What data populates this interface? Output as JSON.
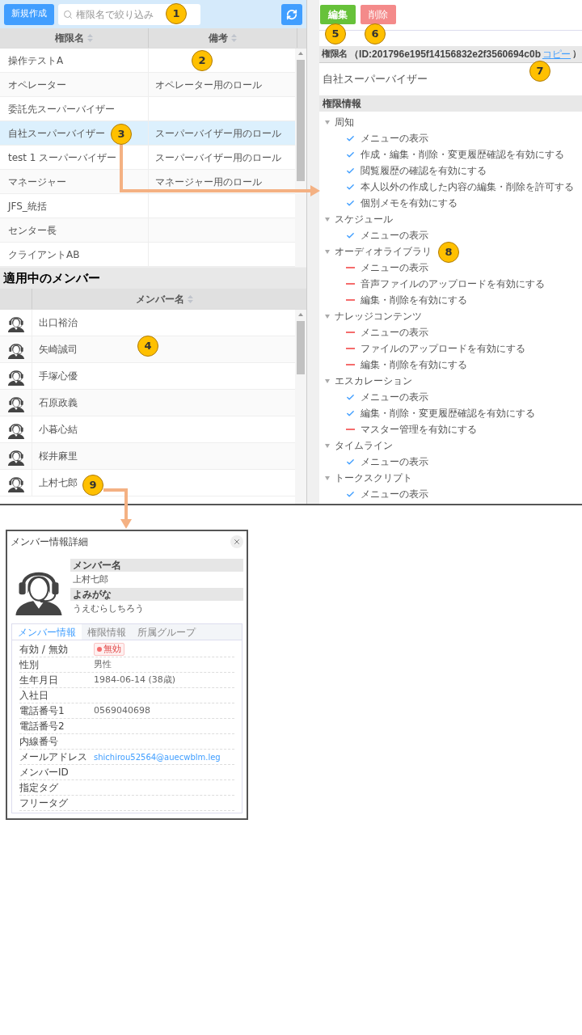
{
  "toolbar": {
    "new_button": "新規作成",
    "search": {
      "placeholder": "権限名で絞り込み"
    }
  },
  "roles_table": {
    "columns": [
      "権限名",
      "備考"
    ],
    "rows": [
      {
        "name": "操作テストA",
        "selected": false
      },
      {
        "name": "オペレーター",
        "note": "オペレーター用のロール",
        "selected": false
      },
      {
        "name": "委託先スーパーバイザー",
        "selected": false
      },
      {
        "name": "自社スーパーバイザー",
        "note": "スーパーバイザー用のロール",
        "selected": true
      },
      {
        "name": "test 1 スーパーバイザー",
        "note": "スーパーバイザー用のロール",
        "selected": false
      },
      {
        "name": "マネージャー",
        "note": "マネージャー用のロール",
        "selected": false
      },
      {
        "name": "JFS_統括",
        "selected": false
      },
      {
        "name": "センター長",
        "selected": false
      },
      {
        "name": "クライアントAB",
        "selected": false
      }
    ]
  },
  "members": {
    "title": "適用中のメンバー",
    "columns": [
      "メンバー名"
    ],
    "rows": [
      {
        "name": "出口裕治"
      },
      {
        "name": "矢崎誠司"
      },
      {
        "name": "手塚心優"
      },
      {
        "name": "石原政義"
      },
      {
        "name": "小暮心結"
      },
      {
        "name": "桜井麻里"
      },
      {
        "name": "上村七郎"
      }
    ]
  },
  "detail": {
    "buttons": [
      {
        "label": "編集",
        "kind": "edit",
        "disabled": false
      },
      {
        "label": "削除",
        "kind": "delete",
        "disabled": true
      }
    ],
    "id_header": {
      "label": "権限名",
      "id": "（ID:201796e195f14156832e2f3560694c0b",
      "copy_link": "コピー",
      "close": "）"
    },
    "name": "自社スーパーバイザー",
    "permissions": {
      "title": "権限情報",
      "groups": [
        {
          "label": "周知",
          "expanded": true,
          "children": [
            {
              "label": "メニューの表示",
              "granted": true
            },
            {
              "label": "作成・編集・削除・変更履歴確認を有効にする",
              "granted": true
            },
            {
              "label": "閲覧履歴の確認を有効にする",
              "granted": true
            },
            {
              "label": "本人以外の作成した内容の編集・削除を許可する",
              "granted": true
            },
            {
              "label": "個別メモを有効にする",
              "granted": true
            }
          ]
        },
        {
          "label": "スケジュール",
          "expanded": true,
          "children": [
            {
              "label": "メニューの表示",
              "granted": true
            }
          ]
        },
        {
          "label": "オーディオライブラリ",
          "expanded": true,
          "children": [
            {
              "label": "メニューの表示",
              "granted": false
            },
            {
              "label": "音声ファイルのアップロードを有効にする",
              "granted": false
            },
            {
              "label": "編集・削除を有効にする",
              "granted": false
            }
          ]
        },
        {
          "label": "ナレッジコンテンツ",
          "expanded": true,
          "children": [
            {
              "label": "メニューの表示",
              "granted": false
            },
            {
              "label": "ファイルのアップロードを有効にする",
              "granted": false
            },
            {
              "label": "編集・削除を有効にする",
              "granted": false
            }
          ]
        },
        {
          "label": "エスカレーション",
          "expanded": true,
          "children": [
            {
              "label": "メニューの表示",
              "granted": true
            },
            {
              "label": "編集・削除・変更履歴確認を有効にする",
              "granted": true
            },
            {
              "label": "マスター管理を有効にする",
              "granted": false
            }
          ]
        },
        {
          "label": "タイムライン",
          "expanded": true,
          "children": [
            {
              "label": "メニューの表示",
              "granted": true
            }
          ]
        },
        {
          "label": "トークスクリプト",
          "expanded": true,
          "children": [
            {
              "label": "メニューの表示",
              "granted": true
            }
          ]
        }
      ]
    }
  },
  "member_dialog": {
    "title": "メンバー情報詳細",
    "fields": [
      {
        "label": "メンバー名",
        "value": "上村七郎"
      },
      {
        "label": "よみがな",
        "value": "うえむらしちろう"
      }
    ],
    "tabs": [
      {
        "label": "メンバー情報",
        "selected": true
      },
      {
        "label": "権限情報",
        "selected": false
      },
      {
        "label": "所属グループ",
        "selected": false
      }
    ],
    "rows": [
      {
        "label": "有効 / 無効",
        "value": "無効",
        "kind": "badge"
      },
      {
        "label": "性別",
        "value": "男性",
        "kind": "text"
      },
      {
        "label": "生年月日",
        "value": "1984-06-14 (38歳)",
        "kind": "text"
      },
      {
        "label": "入社日",
        "kind": "text"
      },
      {
        "label": "電話番号1",
        "value": "0569040698",
        "kind": "text"
      },
      {
        "label": "電話番号2",
        "kind": "text"
      },
      {
        "label": "内線番号",
        "kind": "text"
      },
      {
        "label": "メールアドレス",
        "value": "shichirou52564@auecwblm.leg",
        "kind": "link"
      },
      {
        "label": "メンバーID",
        "kind": "text"
      },
      {
        "label": "指定タグ",
        "kind": "text"
      },
      {
        "label": "フリータグ",
        "kind": "text"
      }
    ]
  },
  "annotations": [
    {
      "number": "1"
    },
    {
      "number": "2"
    },
    {
      "number": "3"
    },
    {
      "number": "4"
    },
    {
      "number": "5"
    },
    {
      "number": "6"
    },
    {
      "number": "7"
    },
    {
      "number": "8"
    },
    {
      "number": "9"
    }
  ]
}
